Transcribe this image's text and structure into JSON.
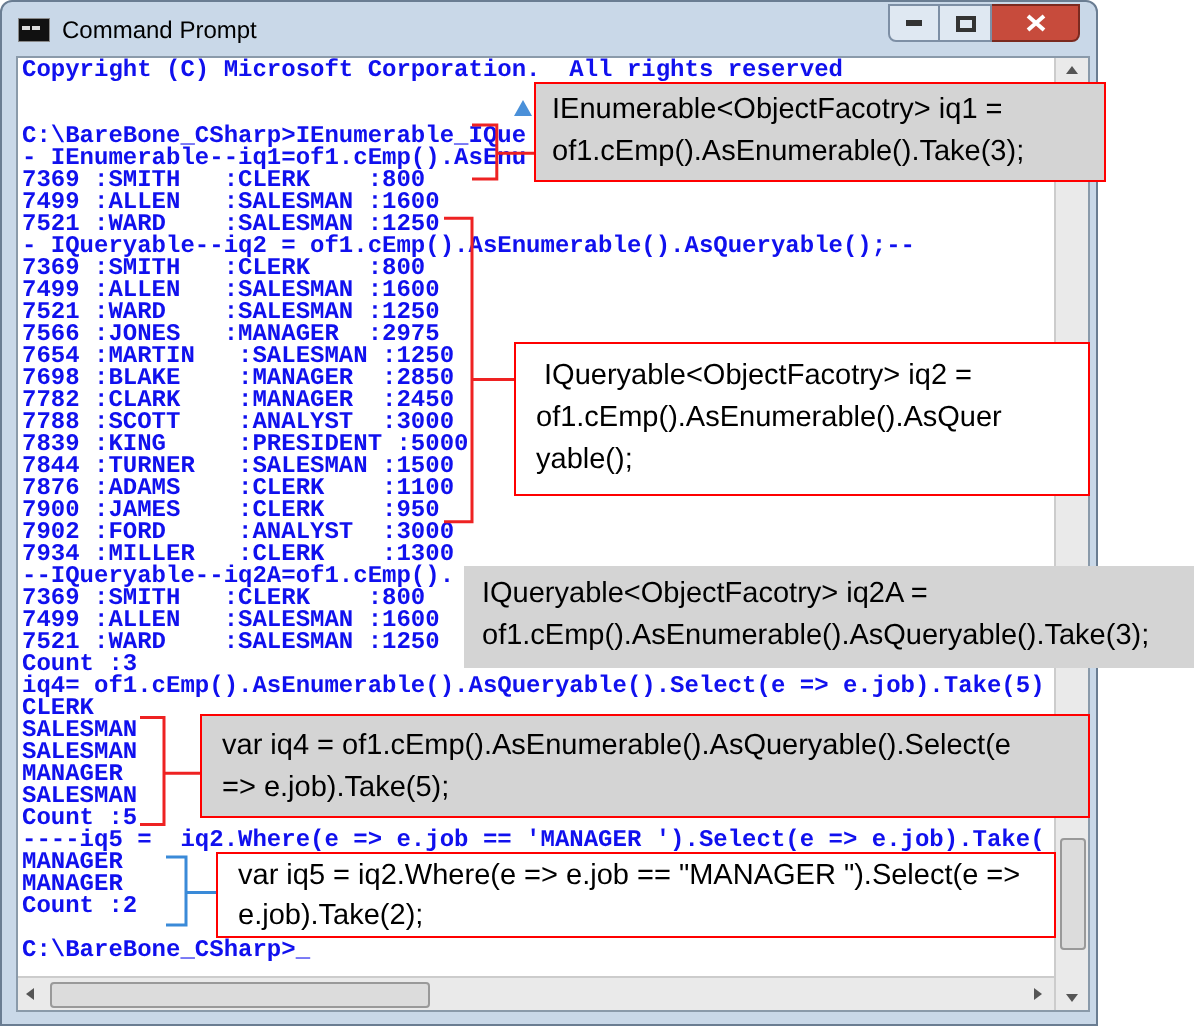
{
  "window": {
    "title": "Command Prompt"
  },
  "console_lines": [
    {
      "kind": "text",
      "text": "Copyright (C) Microsoft Corporation.  All rights reserved"
    },
    {
      "kind": "blank"
    },
    {
      "kind": "blank"
    },
    {
      "kind": "text",
      "text": "C:\\BareBone_CSharp>IEnumerable_IQue"
    },
    {
      "kind": "text",
      "text": "- IEnumerable--iq1=of1.cEmp().AsEnu"
    },
    {
      "kind": "text",
      "text": "7369 :SMITH   :CLERK    :800"
    },
    {
      "kind": "text",
      "text": "7499 :ALLEN   :SALESMAN :1600"
    },
    {
      "kind": "text",
      "text": "7521 :WARD    :SALESMAN :1250"
    },
    {
      "kind": "text",
      "text": "- IQueryable--iq2 = of1.cEmp().AsEnumerable().AsQueryable();--"
    },
    {
      "kind": "text",
      "text": "7369 :SMITH   :CLERK    :800"
    },
    {
      "kind": "text",
      "text": "7499 :ALLEN   :SALESMAN :1600"
    },
    {
      "kind": "text",
      "text": "7521 :WARD    :SALESMAN :1250"
    },
    {
      "kind": "text",
      "text": "7566 :JONES   :MANAGER  :2975"
    },
    {
      "kind": "text",
      "text": "7654 :MARTIN   :SALESMAN :1250"
    },
    {
      "kind": "text",
      "text": "7698 :BLAKE    :MANAGER  :2850"
    },
    {
      "kind": "text",
      "text": "7782 :CLARK    :MANAGER  :2450"
    },
    {
      "kind": "text",
      "text": "7788 :SCOTT    :ANALYST  :3000"
    },
    {
      "kind": "text",
      "text": "7839 :KING     :PRESIDENT :5000"
    },
    {
      "kind": "text",
      "text": "7844 :TURNER   :SALESMAN :1500"
    },
    {
      "kind": "text",
      "text": "7876 :ADAMS    :CLERK    :1100"
    },
    {
      "kind": "text",
      "text": "7900 :JAMES    :CLERK    :950"
    },
    {
      "kind": "text",
      "text": "7902 :FORD     :ANALYST  :3000"
    },
    {
      "kind": "text",
      "text": "7934 :MILLER   :CLERK    :1300"
    },
    {
      "kind": "text",
      "text": "--IQueryable--iq2A=of1.cEmp()."
    },
    {
      "kind": "text",
      "text": "7369 :SMITH   :CLERK    :800"
    },
    {
      "kind": "text",
      "text": "7499 :ALLEN   :SALESMAN :1600"
    },
    {
      "kind": "text",
      "text": "7521 :WARD    :SALESMAN :1250"
    },
    {
      "kind": "text",
      "text": "Count :3"
    },
    {
      "kind": "text",
      "text": "iq4= of1.cEmp().AsEnumerable().AsQueryable().Select(e => e.job).Take(5)"
    },
    {
      "kind": "text",
      "text": "CLERK"
    },
    {
      "kind": "text",
      "text": "SALESMAN"
    },
    {
      "kind": "text",
      "text": "SALESMAN"
    },
    {
      "kind": "text",
      "text": "MANAGER"
    },
    {
      "kind": "text",
      "text": "SALESMAN"
    },
    {
      "kind": "text",
      "text": "Count :5"
    },
    {
      "kind": "text",
      "text": "----iq5 =  iq2.Where(e => e.job == 'MANAGER ').Select(e => e.job).Take("
    },
    {
      "kind": "text",
      "text": "MANAGER"
    },
    {
      "kind": "text",
      "text": "MANAGER"
    },
    {
      "kind": "text",
      "text": "Count :2"
    },
    {
      "kind": "blank"
    },
    {
      "kind": "text",
      "text": "C:\\BareBone_CSharp>_"
    }
  ],
  "callouts": [
    {
      "shaded": true,
      "bordered": true,
      "text": "IEnumerable<ObjectFacotry> iq1 =\nof1.cEmp().AsEnumerable().Take(3);"
    },
    {
      "shaded": false,
      "bordered": true,
      "text": " IQueryable<ObjectFacotry> iq2 =\nof1.cEmp().AsEnumerable().AsQuer\nyable();"
    },
    {
      "shaded": true,
      "bordered": false,
      "text": "IQueryable<ObjectFacotry> iq2A =\nof1.cEmp().AsEnumerable().AsQueryable().Take(3);"
    },
    {
      "shaded": true,
      "bordered": true,
      "text": "var iq4 = of1.cEmp().AsEnumerable().AsQueryable().Select(e\n=> e.job).Take(5);"
    },
    {
      "shaded": false,
      "bordered": true,
      "text": "var iq5 = iq2.Where(e => e.job == \"MANAGER \").Select(e =>\ne.job).Take(2);"
    }
  ]
}
